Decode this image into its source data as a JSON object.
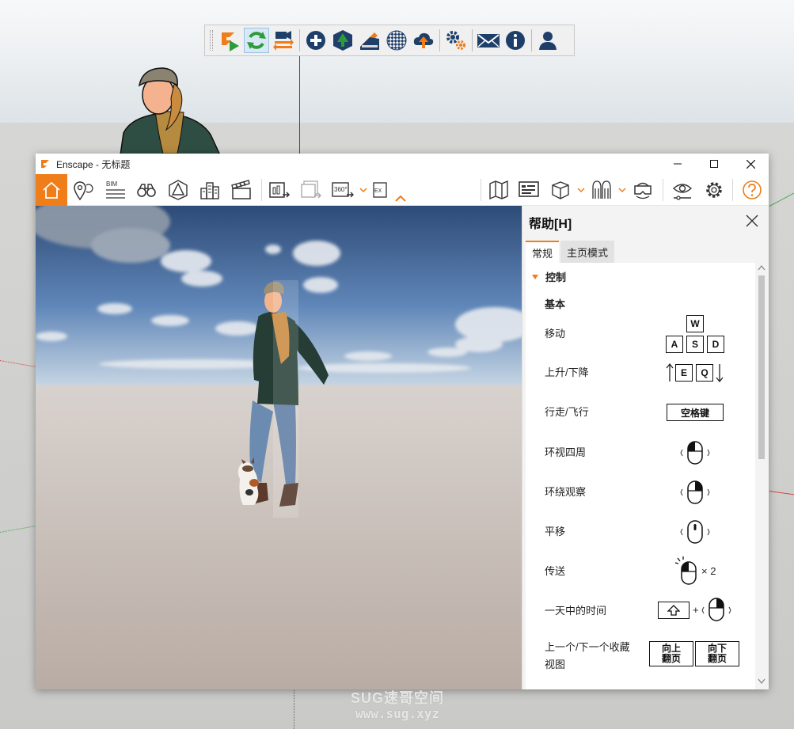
{
  "window": {
    "title": "Enscape - 无标题"
  },
  "colors": {
    "accent": "#ef7d1a",
    "panel_bg": "#f3f3f3",
    "sketchup_axis_blue": "#3b3bd0"
  },
  "sketchup_toolbar": {
    "items": [
      "enscape-start-icon",
      "sync-refresh-icon",
      "sync-views-icon",
      "add-icon",
      "asset-library-icon",
      "material-editor-icon",
      "checkerboard-icon",
      "upload-icon",
      "settings-gears-icon",
      "feedback-mail-icon",
      "about-info-icon",
      "account-icon"
    ]
  },
  "enscape_toolbar": {
    "bim_label": "BIM",
    "panorama_label": "360°",
    "export_label": "EX"
  },
  "help_panel": {
    "title": "帮助[H]",
    "tabs": {
      "general": "常规",
      "home_mode": "主页模式"
    },
    "section_title": "控制",
    "subsection_title": "基本",
    "controls": {
      "move": {
        "label": "移动",
        "keys": [
          "W",
          "A",
          "S",
          "D"
        ]
      },
      "rise_fall": {
        "label": "上升/下降",
        "keys": [
          "E",
          "Q"
        ]
      },
      "walk_fly": {
        "label": "行走/飞行",
        "key": "空格键"
      },
      "look_around": {
        "label": "环视四周"
      },
      "orbit": {
        "label": "环绕观察"
      },
      "pan": {
        "label": "平移"
      },
      "teleport": {
        "label": "传送",
        "suffix": "× 2"
      },
      "time_of_day": {
        "label": "一天中的时间",
        "plus": "+"
      },
      "prev_next_view": {
        "label_line1": "上一个/下一个收藏",
        "label_line2": "视图",
        "key_up_line1": "向上",
        "key_up_line2": "翻页",
        "key_down_line1": "向下",
        "key_down_line2": "翻页"
      }
    }
  },
  "watermark": {
    "line1": "SUG速哥空间",
    "line2": "www.sug.xyz"
  }
}
